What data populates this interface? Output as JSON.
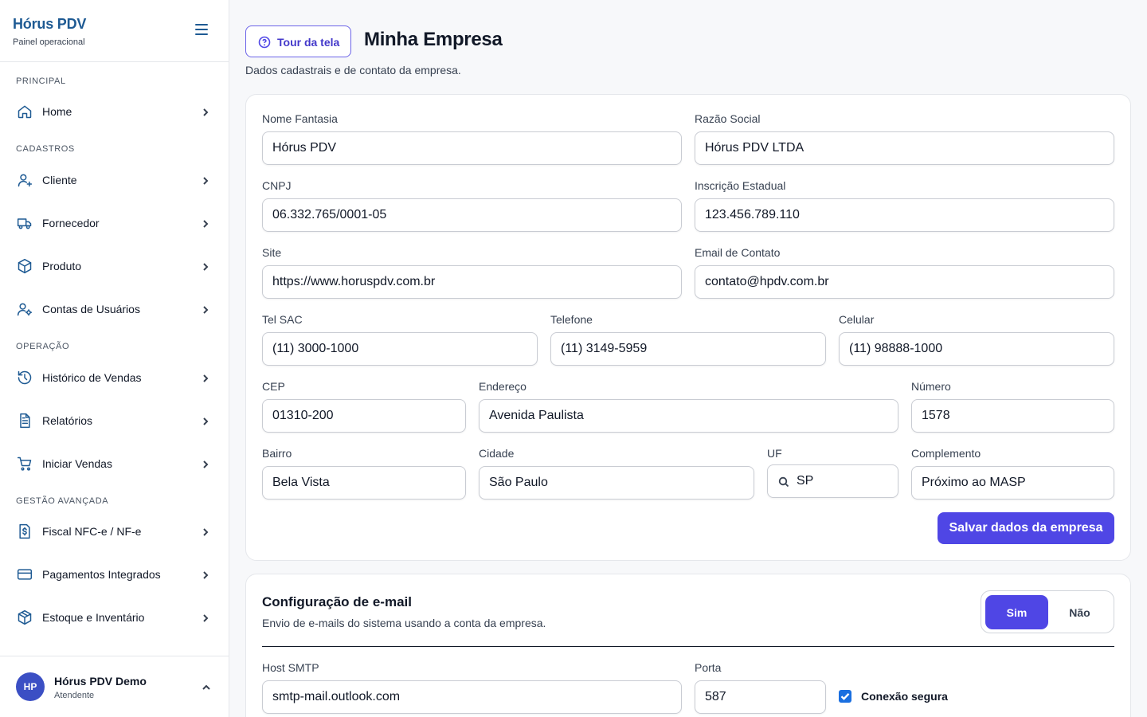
{
  "sidebar": {
    "brand_title": "Hórus PDV",
    "brand_subtitle": "Painel operacional",
    "sections": {
      "principal": "PRINCIPAL",
      "cadastros": "CADASTROS",
      "operacao": "OPERAÇÃO",
      "gestao": "GESTÃO AVANÇADA"
    },
    "items": [
      {
        "label": "Home",
        "icon": "home-icon"
      },
      {
        "label": "Cliente",
        "icon": "user-plus-icon"
      },
      {
        "label": "Fornecedor",
        "icon": "truck-icon"
      },
      {
        "label": "Produto",
        "icon": "package-icon"
      },
      {
        "label": "Contas de Usuários",
        "icon": "user-gear-icon"
      },
      {
        "label": "Histórico de Vendas",
        "icon": "history-icon"
      },
      {
        "label": "Relatórios",
        "icon": "document-icon"
      },
      {
        "label": "Iniciar Vendas",
        "icon": "cart-icon"
      },
      {
        "label": "Fiscal NFC-e / NF-e",
        "icon": "fiscal-dollar-icon"
      },
      {
        "label": "Pagamentos Integrados",
        "icon": "credit-card-icon"
      },
      {
        "label": "Estoque e Inventário",
        "icon": "box-icon"
      }
    ],
    "user": {
      "initials": "HP",
      "name": "Hórus PDV Demo",
      "role": "Atendente"
    }
  },
  "header": {
    "tour_button": "Tour da tela",
    "title": "Minha Empresa",
    "subtitle": "Dados cadastrais e de contato da empresa."
  },
  "company_form": {
    "nome_fantasia": {
      "label": "Nome Fantasia",
      "value": "Hórus PDV"
    },
    "razao_social": {
      "label": "Razão Social",
      "value": "Hórus PDV LTDA"
    },
    "cnpj": {
      "label": "CNPJ",
      "value": "06.332.765/0001-05"
    },
    "inscricao_estadual": {
      "label": "Inscrição Estadual",
      "value": "123.456.789.110"
    },
    "site": {
      "label": "Site",
      "value": "https://www.horuspdv.com.br"
    },
    "email": {
      "label": "Email de Contato",
      "value": "contato@hpdv.com.br"
    },
    "tel_sac": {
      "label": "Tel SAC",
      "value": "(11) 3000-1000"
    },
    "telefone": {
      "label": "Telefone",
      "value": "(11) 3149-5959"
    },
    "celular": {
      "label": "Celular",
      "value": "(11) 98888-1000"
    },
    "cep": {
      "label": "CEP",
      "value": "01310-200"
    },
    "endereco": {
      "label": "Endereço",
      "value": "Avenida Paulista"
    },
    "numero": {
      "label": "Número",
      "value": "1578"
    },
    "bairro": {
      "label": "Bairro",
      "value": "Bela Vista"
    },
    "cidade": {
      "label": "Cidade",
      "value": "São Paulo"
    },
    "uf": {
      "label": "UF",
      "value": "SP"
    },
    "complemento": {
      "label": "Complemento",
      "value": "Próximo ao MASP"
    },
    "save_button": "Salvar dados da empresa"
  },
  "email_config": {
    "title": "Configuração de e-mail",
    "subtitle": "Envio de e-mails do sistema usando a conta da empresa.",
    "toggle_yes": "Sim",
    "toggle_no": "Não",
    "toggle_selected": "Sim",
    "host": {
      "label": "Host SMTP",
      "value": "smtp-mail.outlook.com"
    },
    "porta": {
      "label": "Porta",
      "value": "587"
    },
    "secure_label": "Conexão segura",
    "secure_checked": true
  },
  "colors": {
    "brand": "#1e5a93",
    "accent": "#4f46e5",
    "checkbox": "#1a6fe0"
  }
}
